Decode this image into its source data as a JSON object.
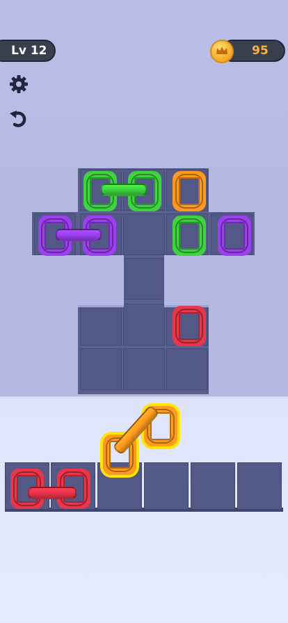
{
  "hud": {
    "level_label": "Lv 12",
    "coins": "95",
    "coin_icon": "crown-coin-icon",
    "settings_icon": "gear-icon",
    "undo_icon": "undo-icon"
  },
  "colors": {
    "green": "#3fd33f",
    "orange": "#ff9a1f",
    "purple": "#9b3ff0",
    "red": "#e8364a",
    "highlight": "#ffe600"
  },
  "board": {
    "pieces": [
      {
        "color": "green",
        "linked": true
      },
      {
        "color": "green",
        "linked": true
      },
      {
        "color": "orange",
        "linked": false
      },
      {
        "color": "purple",
        "linked": true
      },
      {
        "color": "purple",
        "linked": true
      },
      {
        "color": "green",
        "linked": false
      },
      {
        "color": "purple",
        "linked": false
      },
      {
        "color": "red",
        "linked": false
      }
    ]
  },
  "tray": {
    "slot_count": 6,
    "pieces": [
      {
        "color": "red",
        "linked": true
      },
      {
        "color": "red",
        "linked": true
      },
      {
        "color": "orange",
        "linked": true,
        "selected": true
      },
      {
        "color": "orange",
        "linked": true,
        "selected": true
      }
    ]
  }
}
